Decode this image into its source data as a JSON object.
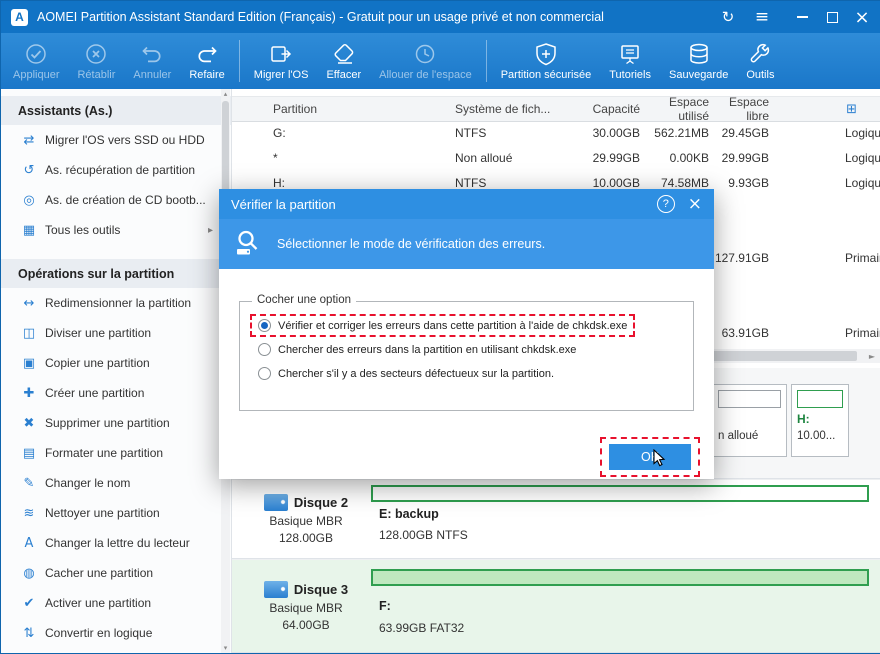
{
  "colors": {
    "titlebar": "#1173c5",
    "accent": "#2e8fe2",
    "annotation_red": "#e8112d",
    "partition_green": "#2f9e4f",
    "sidebar_icon_blue": "#2a7fd0"
  },
  "window": {
    "title": "AOMEI Partition Assistant Standard Edition (Français) - Gratuit pour un usage privé et non commercial"
  },
  "toolbar": {
    "items": [
      {
        "label": "Appliquer"
      },
      {
        "label": "Rétablir"
      },
      {
        "label": "Annuler"
      },
      {
        "label": "Refaire"
      },
      {
        "label": "Migrer l'OS"
      },
      {
        "label": "Effacer"
      },
      {
        "label": "Allouer de l'espace"
      },
      {
        "label": "Partition sécurisée"
      },
      {
        "label": "Tutoriels"
      },
      {
        "label": "Sauvegarde"
      },
      {
        "label": "Outils"
      }
    ]
  },
  "sidebar": {
    "sections": [
      {
        "header": "Assistants (As.)",
        "items": [
          {
            "label": "Migrer l'OS vers SSD ou HDD"
          },
          {
            "label": "As. récupération de partition"
          },
          {
            "label": "As. de création de CD bootb..."
          },
          {
            "label": "Tous les outils"
          }
        ]
      },
      {
        "header": "Opérations sur la partition",
        "items": [
          {
            "label": "Redimensionner la partition"
          },
          {
            "label": "Diviser une partition"
          },
          {
            "label": "Copier une partition"
          },
          {
            "label": "Créer une partition"
          },
          {
            "label": "Supprimer une partition"
          },
          {
            "label": "Formater une partition"
          },
          {
            "label": "Changer le nom"
          },
          {
            "label": "Nettoyer une partition"
          },
          {
            "label": "Changer la lettre du lecteur"
          },
          {
            "label": "Cacher une partition"
          },
          {
            "label": "Activer une partition"
          },
          {
            "label": "Convertir en logique"
          }
        ]
      }
    ]
  },
  "table": {
    "columns": [
      "Partition",
      "Système de fich...",
      "Capacité",
      "Espace utilisé",
      "Espace libre"
    ],
    "rows": [
      {
        "partition": "G:",
        "fs": "NTFS",
        "capacity": "30.00GB",
        "used": "562.21MB",
        "free": "29.45GB",
        "type": "Logiqu"
      },
      {
        "partition": "*",
        "fs": "Non alloué",
        "capacity": "29.99GB",
        "used": "0.00KB",
        "free": "29.99GB",
        "type": "Logiqu"
      },
      {
        "partition": "H:",
        "fs": "NTFS",
        "capacity": "10.00GB",
        "used": "74.58MB",
        "free": "9.93GB",
        "type": "Logiqu"
      },
      {
        "partition": "",
        "fs": "",
        "capacity": "",
        "used": "",
        "free": "127.91GB",
        "type": "Primair"
      },
      {
        "partition": "",
        "fs": "",
        "capacity": "",
        "used": "",
        "free": "63.91GB",
        "type": "Primair"
      }
    ]
  },
  "disks": {
    "disk1": {
      "unallocated_label": "n alloué",
      "h_label": "H:",
      "h_size": "10.00..."
    },
    "disk2": {
      "name": "Disque 2",
      "style": "Basique MBR",
      "size": "128.00GB",
      "partition_label": "E: backup",
      "partition_info": "128.00GB NTFS"
    },
    "disk3": {
      "name": "Disque 3",
      "style": "Basique MBR",
      "size": "64.00GB",
      "partition_label": "F:",
      "partition_info": "63.99GB FAT32"
    }
  },
  "dialog": {
    "title": "Vérifier la partition",
    "subtitle": "Sélectionner le mode de vérification des erreurs.",
    "group_label": "Cocher une option",
    "options": [
      {
        "label": "Vérifier et corriger les erreurs dans cette partition à l'aide de chkdsk.exe"
      },
      {
        "label": "Chercher des erreurs dans la partition en utilisant chkdsk.exe"
      },
      {
        "label": "Chercher s'il y a des secteurs défectueux sur la partition."
      }
    ],
    "ok_label": "OK",
    "help_label": "?"
  },
  "icons": {
    "menu": "≡",
    "refresh": "↻",
    "close": "×",
    "migrate_os_ssd": "⇄",
    "partition_recovery": "↺",
    "bootable_cd": "◎",
    "all_tools": "▦",
    "resize": "↔",
    "split": "◫",
    "copy": "▣",
    "create": "✚",
    "delete": "✖",
    "format": "▤",
    "rename": "✎",
    "wipe": "≋",
    "drive_letter": "A",
    "hide": "◍",
    "activate": "✔",
    "convert_logical": "⇅",
    "chevron_right": "▸",
    "view_switch": "⊞",
    "scroll_left": "◄",
    "scroll_right": "►",
    "scroll_up": "▴",
    "scroll_down": "▾"
  }
}
